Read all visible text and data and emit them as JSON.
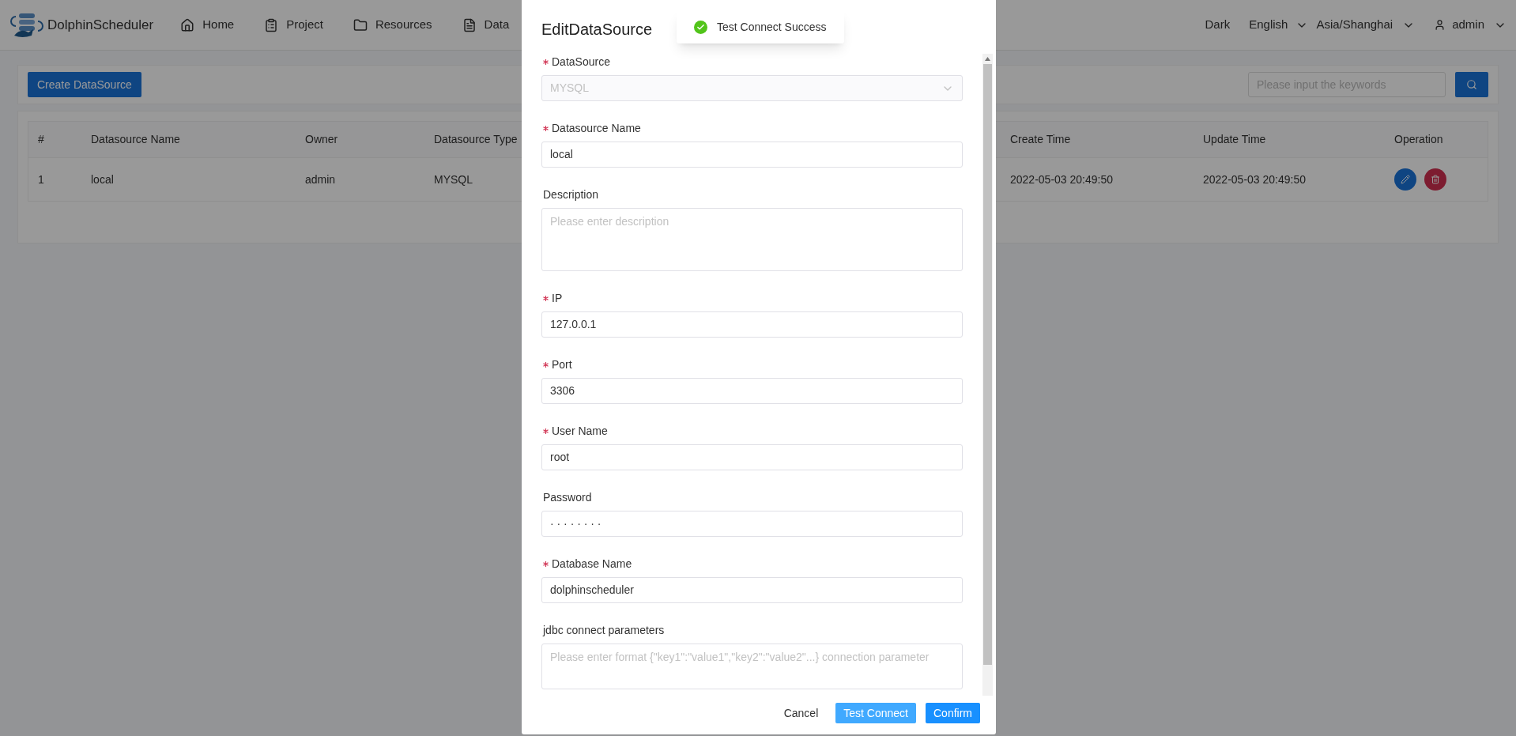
{
  "header": {
    "brand": "DolphinScheduler",
    "nav": [
      {
        "label": "Home"
      },
      {
        "label": "Project"
      },
      {
        "label": "Resources"
      },
      {
        "label": "Data"
      }
    ],
    "theme": "Dark",
    "language": "English",
    "timezone": "Asia/Shanghai",
    "user": "admin"
  },
  "toolbar": {
    "create_button": "Create DataSource",
    "search": {
      "placeholder": "Please input the keywords"
    }
  },
  "table": {
    "columns": [
      "#",
      "Datasource Name",
      "Owner",
      "Datasource Type",
      "Create Time",
      "Update Time",
      "Operation"
    ],
    "rows": [
      {
        "cells": [
          "1",
          "local",
          "admin",
          "MYSQL",
          "2022-05-03 20:49:50",
          "2022-05-03 20:49:50"
        ]
      }
    ]
  },
  "dialog": {
    "title": "EditDataSource",
    "fields": [
      {
        "kind": "select",
        "label": "DataSource",
        "required": true,
        "value": "MYSQL",
        "disabled": true
      },
      {
        "kind": "input",
        "label": "Datasource Name",
        "required": true,
        "value": "local"
      },
      {
        "kind": "textarea",
        "label": "Description",
        "required": false,
        "placeholder": "Please enter description"
      },
      {
        "kind": "input",
        "label": "IP",
        "required": true,
        "value": "127.0.0.1"
      },
      {
        "kind": "input",
        "label": "Port",
        "required": true,
        "value": "3306"
      },
      {
        "kind": "input",
        "label": "User Name",
        "required": true,
        "value": "root"
      },
      {
        "kind": "password",
        "label": "Password",
        "required": false,
        "value": "· · · · · · · ·"
      },
      {
        "kind": "input",
        "label": "Database Name",
        "required": true,
        "value": "dolphinscheduler"
      },
      {
        "kind": "textarea_short",
        "label": "jdbc connect parameters",
        "required": false,
        "placeholder": "Please enter format {\"key1\":\"value1\",\"key2\":\"value2\"...} connection parameter"
      }
    ],
    "buttons": [
      {
        "label": "Cancel",
        "kind": "text"
      },
      {
        "label": "Test Connect",
        "kind": "light"
      },
      {
        "label": "Confirm",
        "kind": "primary"
      }
    ]
  },
  "toast": {
    "message": "Test Connect Success"
  }
}
